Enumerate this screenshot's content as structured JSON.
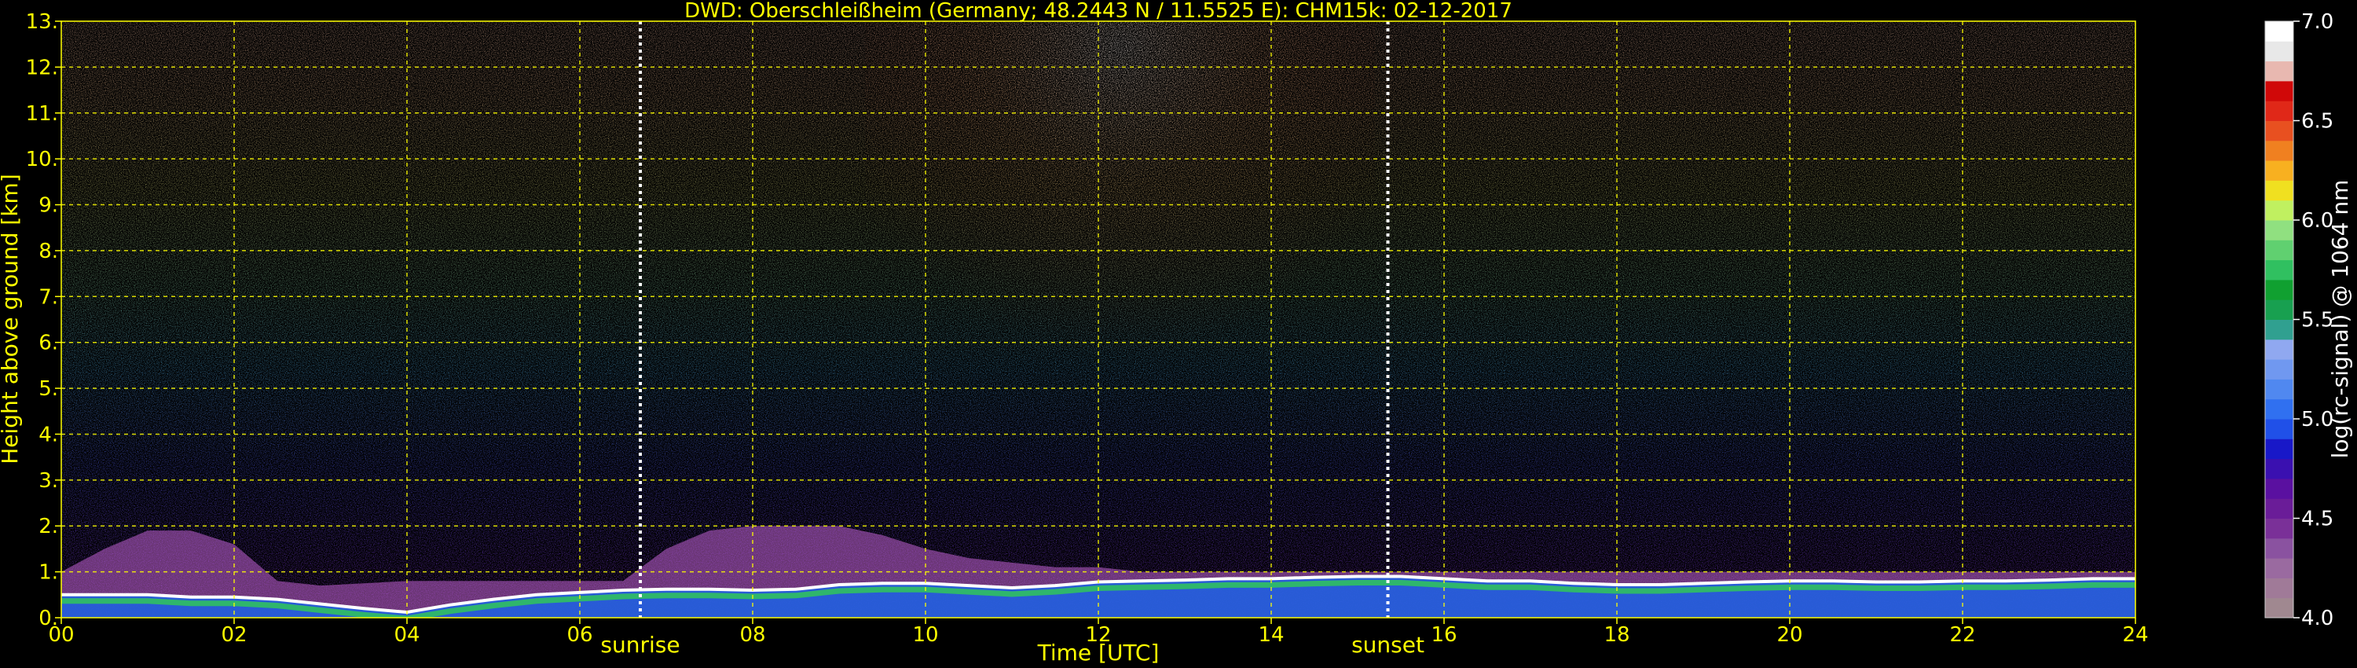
{
  "chart_data": {
    "type": "heatmap",
    "title": "DWD: Oberschleißheim (Germany; 48.2443 N / 11.5525 E):    CHM15k: 02-12-2017",
    "xlabel": "Time [UTC]",
    "ylabel": "Height above ground [km]",
    "xlim": [
      0,
      24
    ],
    "ylim": [
      0,
      13
    ],
    "x_ticks": [
      0,
      2,
      4,
      6,
      8,
      10,
      12,
      14,
      16,
      18,
      20,
      22,
      24
    ],
    "x_tick_labels": [
      "00",
      "02",
      "04",
      "06",
      "08",
      "10",
      "12",
      "14",
      "16",
      "18",
      "20",
      "22",
      "24"
    ],
    "y_ticks": [
      0,
      1,
      2,
      3,
      4,
      5,
      6,
      7,
      8,
      9,
      10,
      11,
      12,
      13
    ],
    "y_tick_labels": [
      "0.",
      "1.",
      "2.",
      "3.",
      "4.",
      "5.",
      "6.",
      "7.",
      "8.",
      "9.",
      "10.",
      "11.",
      "12.",
      "13."
    ],
    "grid": true,
    "grid_color": "#FFFF00",
    "text_color": "#FFFF00",
    "background_color": "#000000",
    "markers": [
      {
        "label": "sunrise",
        "time": 6.7
      },
      {
        "label": "sunset",
        "time": 15.35
      }
    ],
    "colorbar": {
      "label": "log(rc-signal) @ 1064 nm",
      "range": [
        4.0,
        7.0
      ],
      "ticks": [
        4.0,
        4.5,
        5.0,
        5.5,
        6.0,
        6.5,
        7.0
      ],
      "tick_labels": [
        "4.0",
        "4.5",
        "5.0",
        "5.5",
        "6.0",
        "6.5",
        "7.0"
      ],
      "colors": [
        "#a08890",
        "#a07a98",
        "#9a6aa0",
        "#8a52a0",
        "#7a3098",
        "#6a1c98",
        "#5a10a0",
        "#3a10b0",
        "#1818c8",
        "#2050e8",
        "#3070f0",
        "#5088f0",
        "#7098f0",
        "#90a8f0",
        "#30a090",
        "#18a050",
        "#10a030",
        "#30c060",
        "#60d070",
        "#90e080",
        "#c0f060",
        "#f0e020",
        "#f8b020",
        "#f08020",
        "#e85020",
        "#e02818",
        "#d00808",
        "#e8b8b0",
        "#e8e8e8",
        "#ffffff"
      ]
    },
    "profile": {
      "time_grid_step_h": 0.5,
      "boundary_layer_top_km": [
        0.5,
        0.5,
        0.5,
        0.45,
        0.45,
        0.4,
        0.3,
        0.2,
        0.12,
        0.28,
        0.4,
        0.5,
        0.55,
        0.6,
        0.62,
        0.62,
        0.6,
        0.62,
        0.72,
        0.75,
        0.75,
        0.7,
        0.65,
        0.7,
        0.78,
        0.8,
        0.82,
        0.85,
        0.85,
        0.88,
        0.9,
        0.9,
        0.85,
        0.8,
        0.8,
        0.75,
        0.72,
        0.72,
        0.75,
        0.78,
        0.8,
        0.8,
        0.78,
        0.78,
        0.8,
        0.8,
        0.82,
        0.85,
        0.85
      ],
      "residual_layer_top_km": [
        1.0,
        1.5,
        1.9,
        1.9,
        1.6,
        0.8,
        0.7,
        0.75,
        0.8,
        0.8,
        0.8,
        0.8,
        0.8,
        0.8,
        1.5,
        1.9,
        2.0,
        2.0,
        2.0,
        1.8,
        1.5,
        1.3,
        1.2,
        1.1,
        1.1,
        1.0,
        1.0,
        1.0,
        1.0,
        1.0,
        1.0,
        1.0,
        1.0,
        1.0,
        1.0,
        1.0,
        1.0,
        1.0,
        1.0,
        1.0,
        1.0,
        1.0,
        1.0,
        1.0,
        1.0,
        1.0,
        1.0,
        1.0,
        1.0
      ]
    }
  }
}
